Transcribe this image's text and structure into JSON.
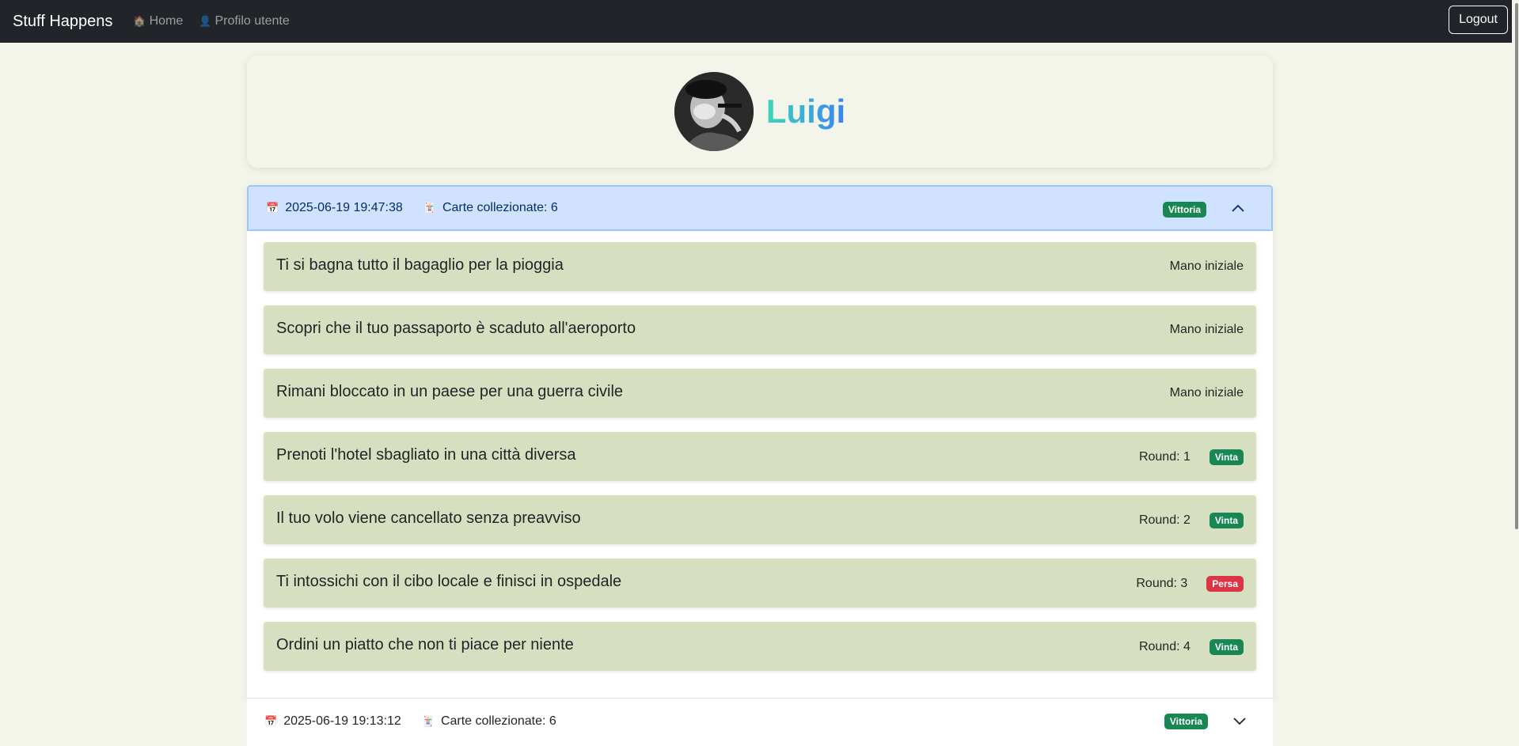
{
  "navbar": {
    "brand": "Stuff Happens",
    "home_label": "Home",
    "profile_label": "Profilo utente",
    "logout_label": "Logout"
  },
  "profile": {
    "username": "Luigi"
  },
  "games": [
    {
      "date": "2025-06-19 19:47:38",
      "cards_label": "Carte collezionate: 6",
      "result": "Vittoria",
      "expanded": true,
      "cards": [
        {
          "title": "Ti si bagna tutto il bagaglio per la pioggia",
          "meta": "Mano iniziale"
        },
        {
          "title": "Scopri che il tuo passaporto è scaduto all'aeroporto",
          "meta": "Mano iniziale"
        },
        {
          "title": "Rimani bloccato in un paese per una guerra civile",
          "meta": "Mano iniziale"
        },
        {
          "title": "Prenoti l'hotel sbagliato in una città diversa",
          "meta": "Round: 1",
          "badge": "Vinta"
        },
        {
          "title": "Il tuo volo viene cancellato senza preavviso",
          "meta": "Round: 2",
          "badge": "Vinta"
        },
        {
          "title": "Ti intossichi con il cibo locale e finisci in ospedale",
          "meta": "Round: 3",
          "badge": "Persa"
        },
        {
          "title": "Ordini un piatto che non ti piace per niente",
          "meta": "Round: 4",
          "badge": "Vinta"
        }
      ]
    },
    {
      "date": "2025-06-19 19:13:12",
      "cards_label": "Carte collezionate: 6",
      "result": "Vittoria",
      "expanded": false
    }
  ],
  "icons": {
    "home": "house-icon",
    "profile": "user-icon",
    "date": "calendar-icon",
    "cards": "cards-icon",
    "expand": "chevron-up-icon",
    "collapse": "chevron-down-icon"
  },
  "colors": {
    "navbar": "#212529",
    "background": "#f4f5ea",
    "header_active": "#cfe2ff",
    "card": "#d6dfc0",
    "win_badge": "#198754",
    "lose_badge": "#dc3545"
  }
}
